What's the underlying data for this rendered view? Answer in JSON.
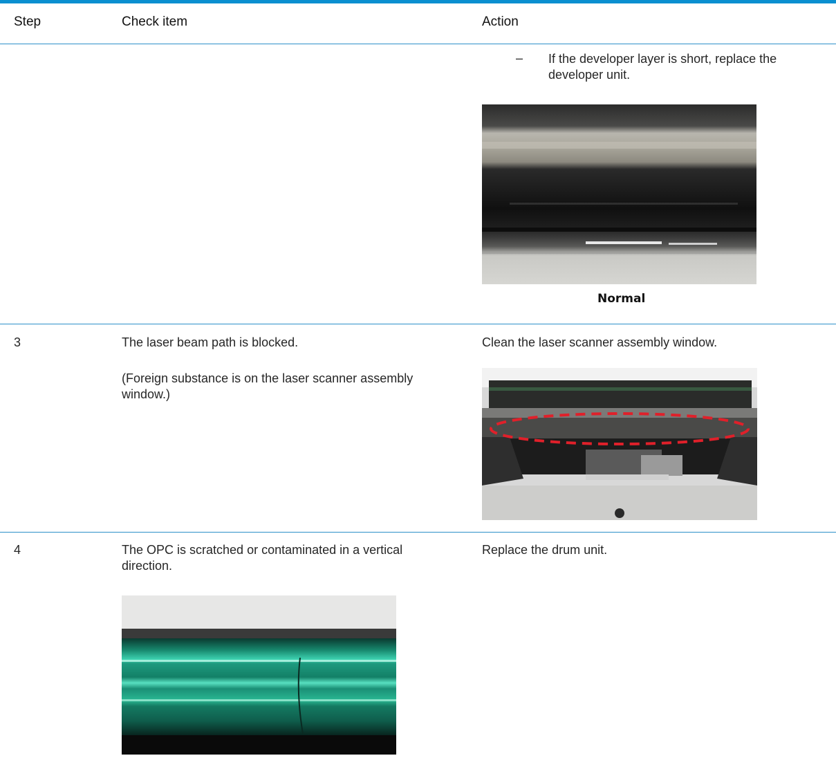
{
  "table": {
    "headers": {
      "step": "Step",
      "check": "Check item",
      "action": "Action"
    },
    "rows": [
      {
        "step": "",
        "check": "",
        "action_bullet_marker": "–",
        "action_bullet": "If the developer layer is short, replace the developer unit.",
        "image_caption": "Normal"
      },
      {
        "step": "3",
        "check": "The laser beam path is blocked.",
        "check_note": "(Foreign substance is on the laser scanner assembly window.)",
        "action": "Clean the laser scanner assembly window."
      },
      {
        "step": "4",
        "check": "The OPC is scratched or contaminated in a vertical direction.",
        "action": "Replace the drum unit."
      }
    ]
  },
  "colors": {
    "accent": "#0a8fd0",
    "rule": "#2b8fc9",
    "highlight": "#e0202a"
  }
}
